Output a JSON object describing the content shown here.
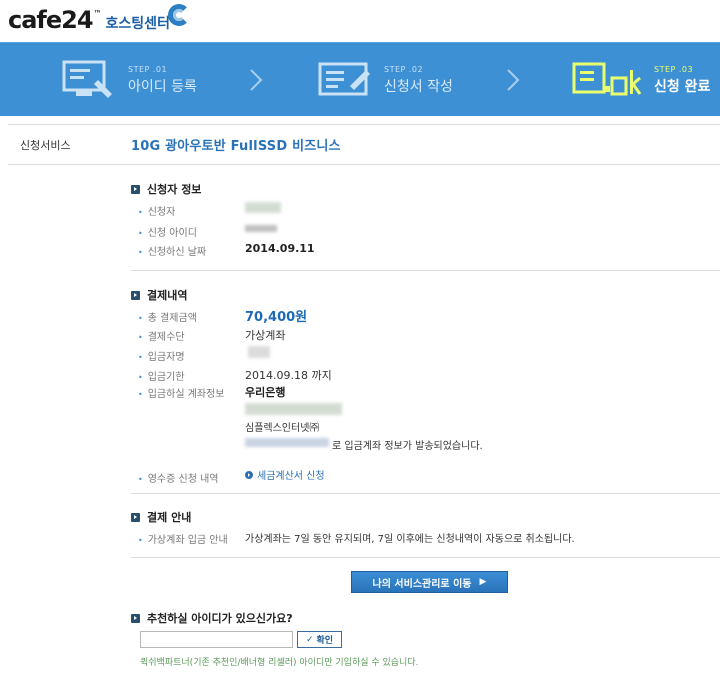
{
  "header": {
    "logo_text": "cafe24",
    "logo_tm": "™",
    "logo_sub": "호스팅센터"
  },
  "steps": [
    {
      "num": "STEP .01",
      "title": "아이디 등록",
      "active": false
    },
    {
      "num": "STEP .02",
      "title": "신청서 작성",
      "active": false
    },
    {
      "num": "STEP .03",
      "title": "신청 완료",
      "active": true
    }
  ],
  "colors": {
    "steps_bg": "#3e90d4",
    "active_accent": "#e9ff6d",
    "link_blue": "#2a72b8"
  },
  "service": {
    "label": "신청서비스",
    "value": "10G 광아우토반 FullSSD 비즈니스"
  },
  "applicant": {
    "title": "신청자 정보",
    "fields": [
      {
        "label": "신청자",
        "value": ""
      },
      {
        "label": "신청 아이디",
        "value": ""
      },
      {
        "label": "신청하신 날짜",
        "value": "2014.09.11"
      }
    ]
  },
  "payment": {
    "title": "결제내역",
    "total_label": "총 결제금액",
    "total_value": "70,400원",
    "method_label": "결제수단",
    "method_value": "가상계좌",
    "depositor_label": "입금자명",
    "deadline_label": "입금기한",
    "deadline_value": "2014.09.18 까지",
    "account_label": "입금하실 계좌정보",
    "bank_name": "우리은행",
    "holder": "심플렉스인터넷㈜",
    "sent_msg": "로 입금계좌 정보가 발송되었습니다.",
    "receipt_label": "영수증 신청 내역",
    "receipt_link": "세금계산서 신청"
  },
  "notice": {
    "title": "결제 안내",
    "label": "가상계좌 입금 안내",
    "text": "가상계좌는 7일 동안 유지되며, 7일 이후에는 신청내역이 자동으로 취소됩니다."
  },
  "main_button": {
    "label": "나의 서비스관리로 이동",
    "arrow": "▶"
  },
  "recommend": {
    "title": "추천하실 아이디가 있으신가요?",
    "input_value": "",
    "input_placeholder": "",
    "confirm_check": "✓",
    "confirm_label": "확인",
    "note": "퀵쉬백파트너(기존 추천인/배너형 리셀러) 아이디만 기입하실 수 있습니다."
  }
}
